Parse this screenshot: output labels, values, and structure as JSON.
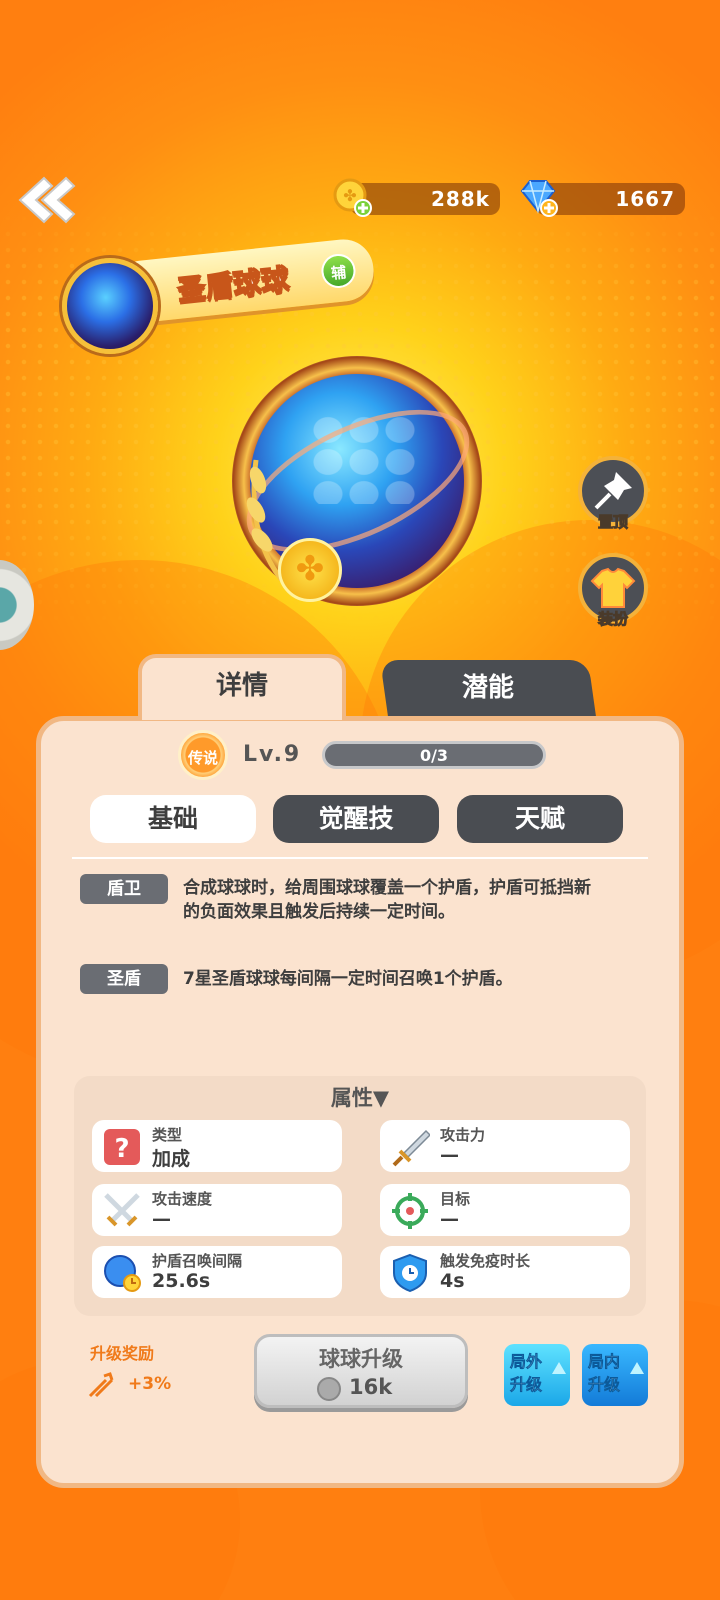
{
  "resources": {
    "coins": "288k",
    "gems": "1667"
  },
  "hero": {
    "name": "圣盾球球",
    "role": "辅"
  },
  "side_buttons": {
    "pin": "置顶",
    "outfit": "装扮"
  },
  "tabs": {
    "details": "详情",
    "potential": "潜能"
  },
  "level": {
    "rarity": "传说",
    "label": "Lv.9",
    "progress_text": "0/3",
    "progress_fraction": 0.0
  },
  "subtabs": {
    "basic": "基础",
    "awaken": "觉醒技",
    "talent": "天赋"
  },
  "skills": [
    {
      "tag": "盾卫",
      "desc": "合成球球时，给周围球球覆盖一个护盾，护盾可抵挡新的负面效果且触发后持续一定时间。"
    },
    {
      "tag": "圣盾",
      "desc": "7星圣盾球球每间隔一定时间召唤1个护盾。"
    }
  ],
  "attributes": {
    "title": "属性▼",
    "items": [
      {
        "label": "类型",
        "value": "加成"
      },
      {
        "label": "攻击力",
        "value": "—"
      },
      {
        "label": "攻击速度",
        "value": "—"
      },
      {
        "label": "目标",
        "value": "—"
      },
      {
        "label": "护盾召唤间隔",
        "value": "25.6s"
      },
      {
        "label": "触发免疫时长",
        "value": "4s"
      }
    ]
  },
  "footer": {
    "reward_title": "升级奖励",
    "reward_value": "+3%",
    "upgrade_label": "球球升级",
    "upgrade_cost": "16k",
    "outer_upgrade": "局外升级",
    "inner_upgrade": "局内升级"
  }
}
